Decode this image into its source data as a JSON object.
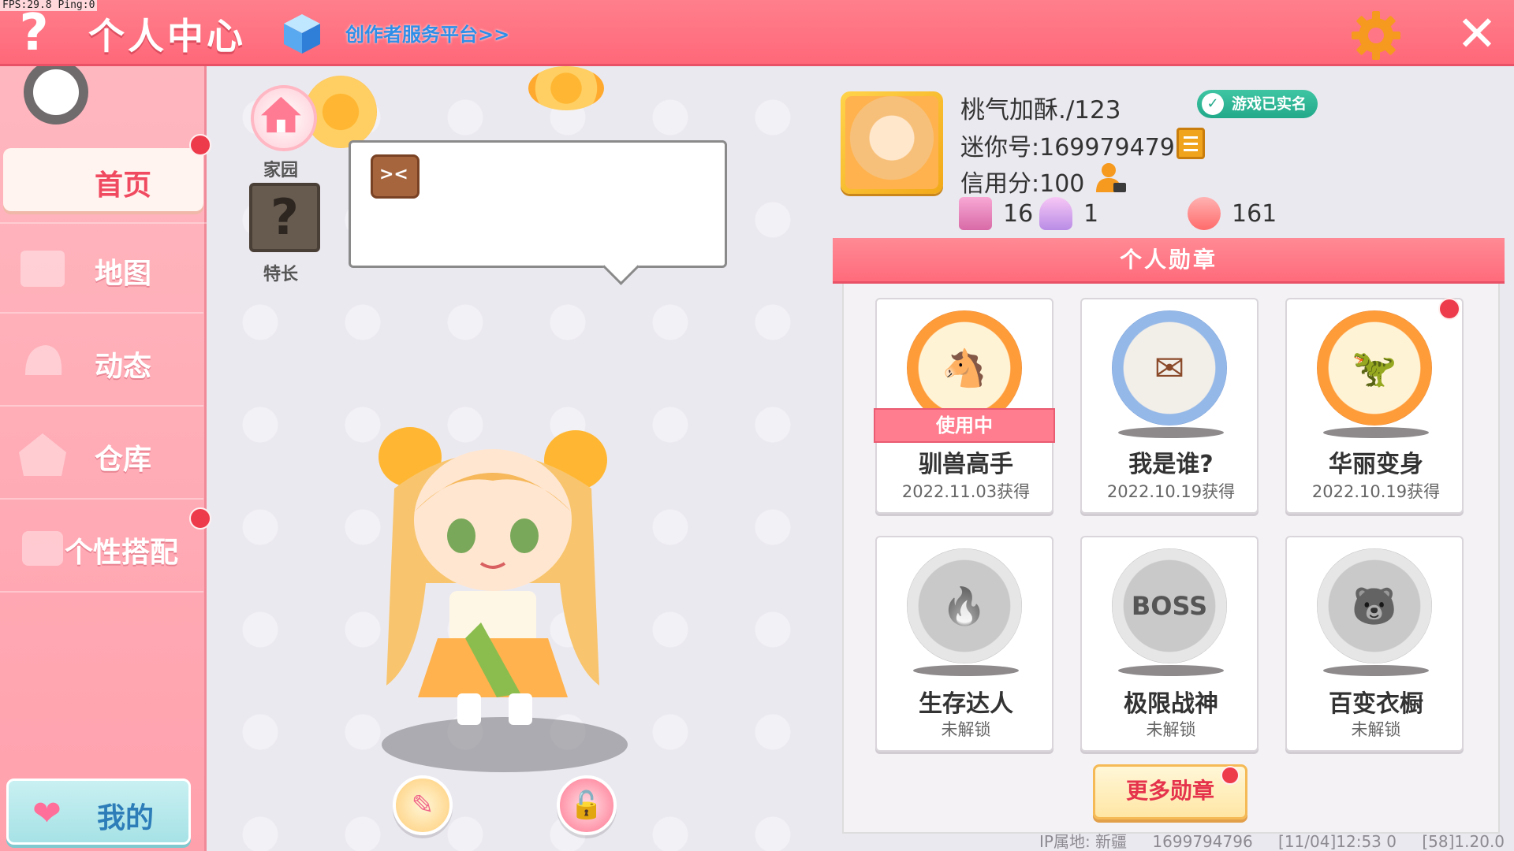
{
  "debug": {
    "fps_text": "FPS:29.8  Ping:0"
  },
  "header": {
    "help_glyph": "?",
    "title": "个人中心",
    "creator_link": "创作者服务平台>>",
    "close_glyph": "✕"
  },
  "sidebar": {
    "items": [
      {
        "label": "首页",
        "active": true,
        "badge": true
      },
      {
        "label": "地图",
        "active": false,
        "badge": false
      },
      {
        "label": "动态",
        "active": false,
        "badge": false
      },
      {
        "label": "仓库",
        "active": false,
        "badge": false
      },
      {
        "label": "个性搭配",
        "active": false,
        "badge": true
      }
    ],
    "mine_label": "我的"
  },
  "center": {
    "home_label": "家园",
    "skill_glyph": "?",
    "skill_label": "特长"
  },
  "profile": {
    "nickname": "桃气加酥./123",
    "realname_badge": "游戏已实名",
    "mini_id": "迷你号:1699794796",
    "credit": "信用分:100",
    "stats": [
      {
        "icon": "plus-ribbon-icon",
        "value": "16",
        "color": "#e98bc4"
      },
      {
        "icon": "cheer-icon",
        "value": "1",
        "color": "#b98ce6"
      },
      {
        "icon": "flame-icon",
        "value": "161",
        "color": "#ff7a7a"
      }
    ]
  },
  "badges": {
    "header": "个人勋章",
    "items": [
      {
        "name": "驯兽高手",
        "sub": "2022.11.03获得",
        "style": "gold",
        "glyph": "🐴",
        "in_use": true,
        "in_use_label": "使用中",
        "new": false
      },
      {
        "name": "我是谁?",
        "sub": "2022.10.19获得",
        "style": "blue",
        "glyph": "✉",
        "in_use": false,
        "new": false
      },
      {
        "name": "华丽变身",
        "sub": "2022.10.19获得",
        "style": "gold",
        "glyph": "🦖",
        "in_use": false,
        "new": true
      },
      {
        "name": "生存达人",
        "sub": "未解锁",
        "style": "gray",
        "glyph": "🔥",
        "in_use": false,
        "new": false
      },
      {
        "name": "极限战神",
        "sub": "未解锁",
        "style": "gray",
        "glyph": "BOSS",
        "in_use": false,
        "new": false
      },
      {
        "name": "百变衣橱",
        "sub": "未解锁",
        "style": "gray",
        "glyph": "🐻",
        "in_use": false,
        "new": false
      }
    ],
    "more_label": "更多勋章"
  },
  "footer": {
    "ip": "IP属地: 新疆",
    "uid": "1699794796",
    "time": "[11/04]12:53 0",
    "version": "[58]1.20.0"
  },
  "colors": {
    "accent": "#ff6879",
    "sidebar": "#ffb7bf",
    "badge_dot": "#ee3b4c"
  }
}
